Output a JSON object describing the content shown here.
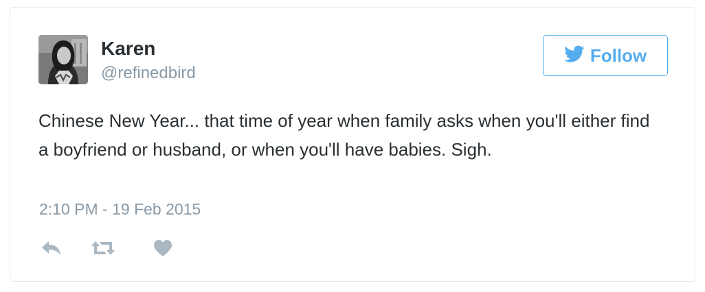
{
  "author": {
    "display_name": "Karen",
    "handle": "@refinedbird",
    "avatar_icon": "avatar-photo"
  },
  "follow_button": {
    "label": "Follow",
    "icon": "twitter-bird-icon",
    "color": "#55acee"
  },
  "tweet": {
    "text": "Chinese New Year... that time of year when family asks when you'll either find a boyfriend or husband, or when you'll have babies. Sigh.",
    "timestamp": "2:10 PM - 19 Feb 2015"
  },
  "actions": [
    {
      "name": "reply",
      "icon": "reply-icon"
    },
    {
      "name": "retweet",
      "icon": "retweet-icon"
    },
    {
      "name": "like",
      "icon": "heart-icon"
    }
  ],
  "colors": {
    "text": "#292f33",
    "muted": "#8899a6",
    "action_icons": "#aab8c2",
    "border": "#e1e8ed"
  }
}
